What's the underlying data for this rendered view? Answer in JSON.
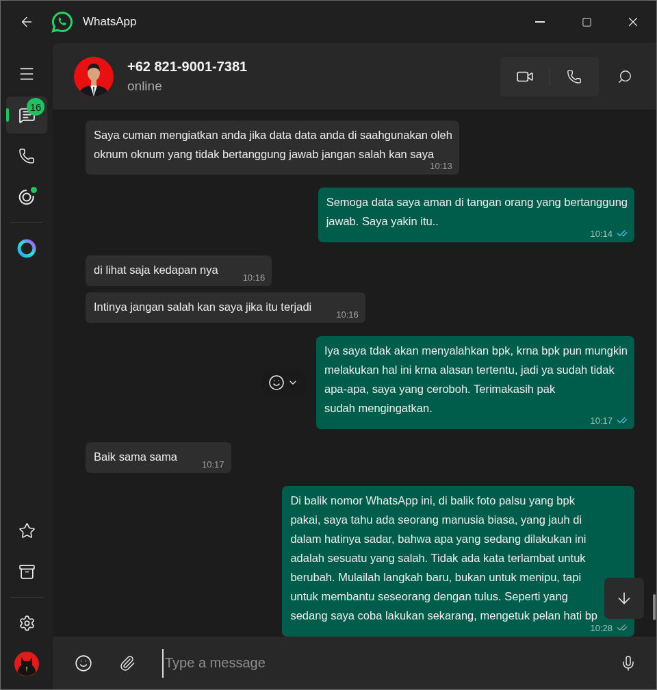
{
  "window": {
    "title": "WhatsApp"
  },
  "nav": {
    "top_items": [
      {
        "kind": "menu",
        "selected": false
      },
      {
        "kind": "chats",
        "selected": true,
        "badge": "16"
      },
      {
        "kind": "calls",
        "selected": false
      },
      {
        "kind": "status",
        "selected": false,
        "has_update": true
      },
      {
        "kind": "meta_ai",
        "selected": false
      }
    ],
    "bottom_items": [
      {
        "kind": "starred",
        "selected": false
      },
      {
        "kind": "archived",
        "selected": false
      },
      {
        "kind": "settings",
        "selected": false
      },
      {
        "kind": "profile",
        "selected": false
      }
    ]
  },
  "chat": {
    "contact": {
      "name": "+62 821-9001-7381",
      "status": "online"
    },
    "messages": [
      {
        "kind": "incoming",
        "text": "Saya cuman mengiatkan anda jika data data anda di saahgunakan oleh\noknum oknum yang tidak bertanggung jawab jangan salah kan saya",
        "time": "10:13",
        "show_reaction": false
      },
      {
        "kind": "outgoing",
        "text": "Semoga data saya aman di tangan orang yang bertanggung\njawab. Saya yakin itu..",
        "time": "10:14",
        "read": true,
        "show_reaction": false
      },
      {
        "kind": "incoming",
        "text": "di lihat saja kedapan nya",
        "time": "10:16",
        "show_reaction": false
      },
      {
        "kind": "incoming",
        "text": "Intinya jangan salah kan saya jika itu terjadi",
        "time": "10:16",
        "show_reaction": false
      },
      {
        "kind": "outgoing",
        "text": "Iya saya tdak akan menyalahkan bpk, krna bpk pun mungkin\nmelakukan hal ini krna alasan tertentu, jadi ya sudah tidak\napa-apa, saya yang ceroboh. Terimakasih pak\nsudah mengingatkan.",
        "time": "10:17",
        "read": true,
        "show_reaction": true
      },
      {
        "kind": "incoming",
        "text": "Baik sama sama",
        "time": "10:17",
        "show_reaction": false
      },
      {
        "kind": "outgoing",
        "text": "Di balik nomor WhatsApp ini, di balik foto palsu yang bpk\npakai, saya tahu ada seorang manusia biasa, yang jauh di\ndalam hatinya sadar, bahwa apa yang sedang dilakukan ini\nadalah sesuatu yang salah. Tidak ada kata terlambat untuk\nberubah. Mulailah langkah baru, bukan untuk menipu, tapi\nuntuk membantu seseorang dengan tulus. Seperti yang\nsedang saya coba lakukan sekarang, mengetuk pelan hati bp",
        "time": "10:28",
        "read": false,
        "show_reaction": false
      }
    ]
  },
  "composer": {
    "placeholder": "Type a message"
  }
}
